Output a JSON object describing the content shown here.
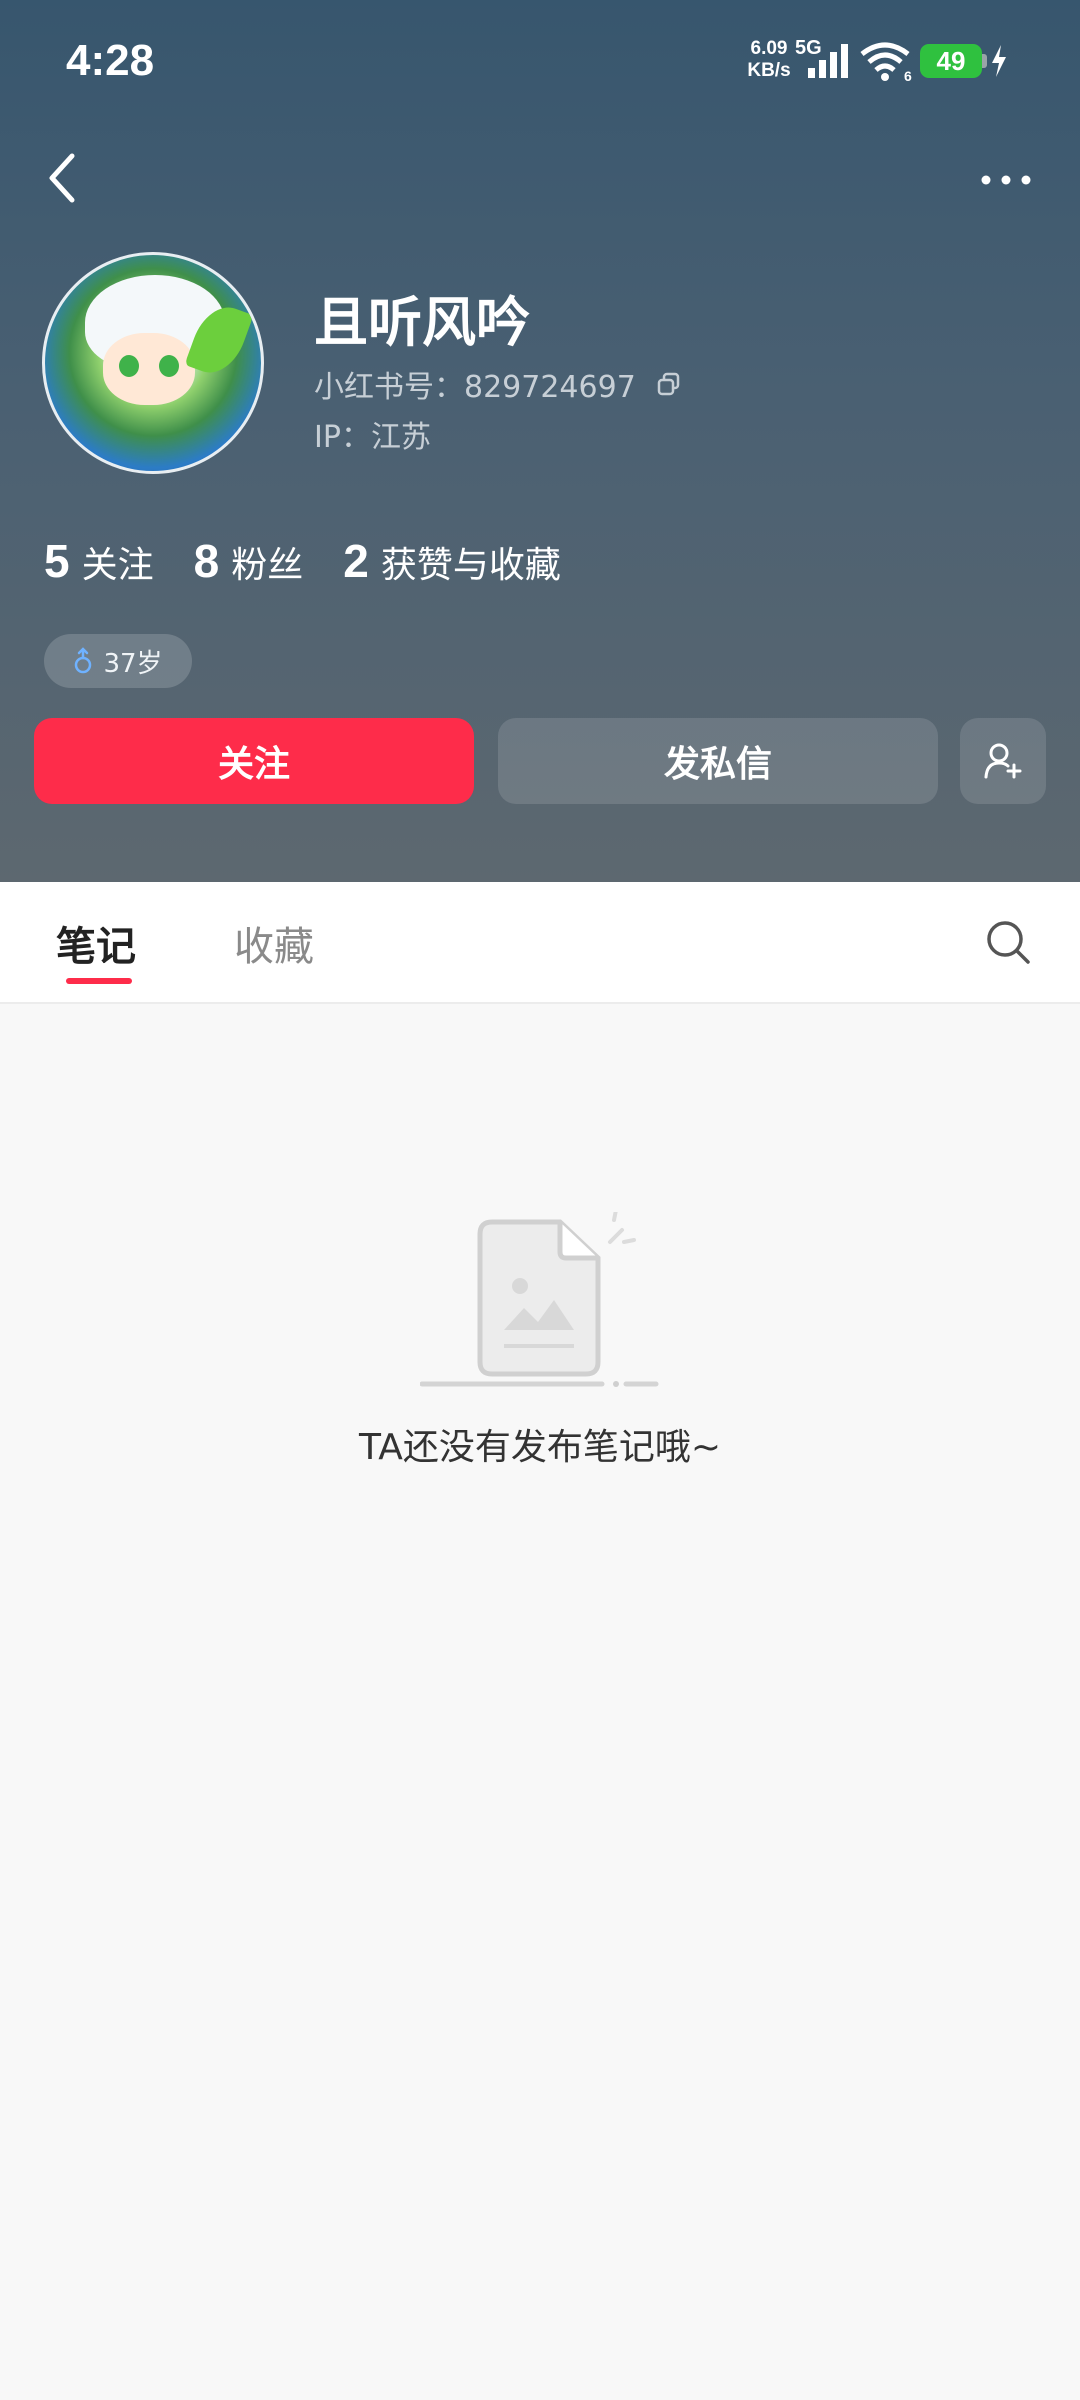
{
  "status_bar": {
    "time": "4:28",
    "net_speed_value": "6.09",
    "net_speed_unit": "KB/s",
    "net_type": "5G",
    "wifi_badge": "6",
    "battery": "49"
  },
  "profile": {
    "nickname": "且听风吟",
    "user_id": "小红书号：829724697",
    "ip": "IP：江苏",
    "age": "37岁"
  },
  "stats": [
    {
      "value": "5",
      "label": "关注"
    },
    {
      "value": "8",
      "label": "粉丝"
    },
    {
      "value": "2",
      "label": "获赞与收藏"
    }
  ],
  "actions": {
    "follow": "关注",
    "message": "发私信"
  },
  "tabs": [
    {
      "label": "笔记",
      "active": true
    },
    {
      "label": "收藏",
      "active": false
    }
  ],
  "empty_state": {
    "text": "TA还没有发布笔记哦~"
  },
  "colors": {
    "accent": "#fe2c4a",
    "header_top": "#37566e",
    "header_bottom": "#5d6870"
  },
  "icons": [
    "back-icon",
    "more-icon",
    "copy-icon",
    "male-icon",
    "add-friend-icon",
    "search-icon",
    "empty-note-icon",
    "signal-icon",
    "wifi-icon",
    "charging-icon"
  ]
}
